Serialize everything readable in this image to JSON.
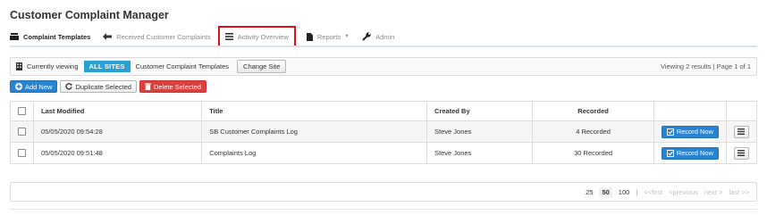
{
  "app": {
    "title": "Customer Complaint Manager"
  },
  "nav": {
    "items": [
      {
        "label": "Complaint Templates",
        "icon": "templates-icon",
        "active": true
      },
      {
        "label": "Received Customer Complaints",
        "icon": "arrow-left-icon"
      },
      {
        "label": "Activity Overview",
        "icon": "activity-icon",
        "highlighted": true
      },
      {
        "label": "Reports",
        "icon": "document-icon",
        "dropdown": true
      },
      {
        "label": "Admin",
        "icon": "wrench-icon"
      }
    ]
  },
  "viewbar": {
    "prefix": "Currently viewing",
    "scope": "ALL SITES",
    "suffix": "Customer Complaint Templates",
    "change_label": "Change Site",
    "summary": "Viewing 2 results | Page 1 of 1"
  },
  "toolbar": {
    "add_label": "Add New",
    "duplicate_label": "Duplicate Selected",
    "delete_label": "Delete Selected"
  },
  "table": {
    "columns": [
      "Last Modified",
      "Title",
      "Created By",
      "Recorded"
    ],
    "rows": [
      {
        "modified": "05/05/2020 09:54:28",
        "title": "SB Customer Complaints Log",
        "created_by": "Steve Jones",
        "recorded": "4 Recorded",
        "action": "Record Now"
      },
      {
        "modified": "05/05/2020 09:51:48",
        "title": "Complaints Log",
        "created_by": "Steve Jones",
        "recorded": "30 Recorded",
        "action": "Record Now"
      }
    ]
  },
  "pager": {
    "sizes": [
      "25",
      "50",
      "100"
    ],
    "separator": "|",
    "first": "<<first",
    "previous": "<previous",
    "next": "next >",
    "last": "last >>"
  },
  "colors": {
    "accent": "#2a83d0",
    "scope_badge": "#2aa1d6",
    "danger": "#d9413e",
    "highlight_box": "#e0101a"
  }
}
